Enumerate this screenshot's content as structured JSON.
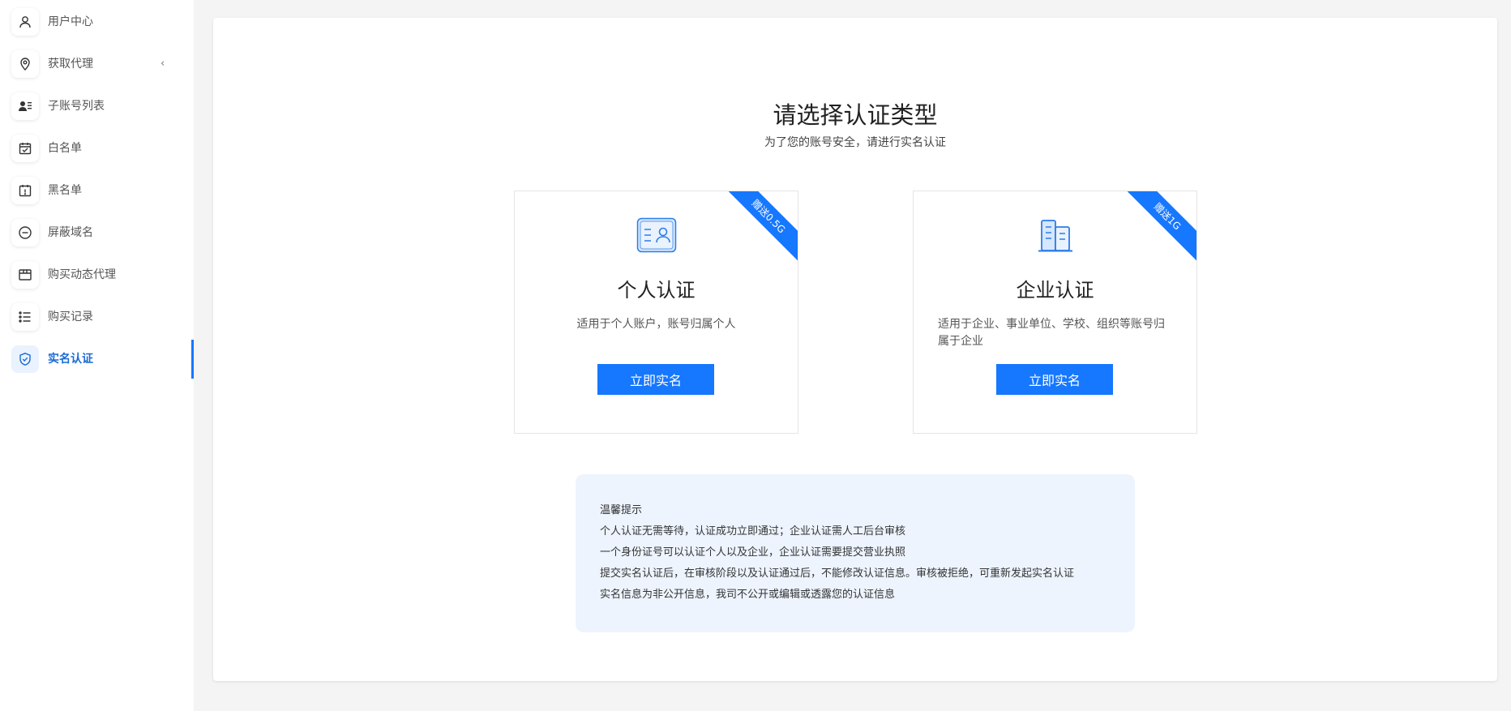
{
  "sidebar": {
    "items": [
      {
        "label": "用户中心",
        "icon": "user-icon"
      },
      {
        "label": "获取代理",
        "icon": "location-pin-icon",
        "chevron": "‹"
      },
      {
        "label": "子账号列表",
        "icon": "sub-account-list-icon"
      },
      {
        "label": "白名单",
        "icon": "calendar-check-icon"
      },
      {
        "label": "黑名单",
        "icon": "calendar-alert-icon"
      },
      {
        "label": "屏蔽域名",
        "icon": "minus-circle-icon"
      },
      {
        "label": "购买动态代理",
        "icon": "box-icon"
      },
      {
        "label": "购买记录",
        "icon": "list-icon"
      },
      {
        "label": "实名认证",
        "icon": "shield-check-icon",
        "active": true
      }
    ]
  },
  "main": {
    "title": "请选择认证类型",
    "subtitle": "为了您的账号安全，请进行实名认证",
    "cards": [
      {
        "ribbon": "赠送0.5G",
        "title": "个人认证",
        "description": "适用于个人账户，账号归属个人",
        "button": "立即实名",
        "icon": "id-card-icon"
      },
      {
        "ribbon": "赠送1G",
        "title": "企业认证",
        "description": "适用于企业、事业单位、学校、组织等账号归属于企业",
        "button": "立即实名",
        "icon": "building-icon"
      }
    ],
    "tips": {
      "heading": "温馨提示",
      "lines": [
        "个人认证无需等待，认证成功立即通过；企业认证需人工后台审核",
        "一个身份证号可以认证个人以及企业，企业认证需要提交营业执照",
        "提交实名认证后，在审核阶段以及认证通过后，不能修改认证信息。审核被拒绝，可重新发起实名认证",
        "实名信息为非公开信息，我司不公开或编辑或透露您的认证信息"
      ]
    }
  },
  "colors": {
    "accent": "#1677ff",
    "active_text": "#1a6bd6",
    "tips_background": "#edf4fe",
    "page_background": "#f4f4f4"
  }
}
